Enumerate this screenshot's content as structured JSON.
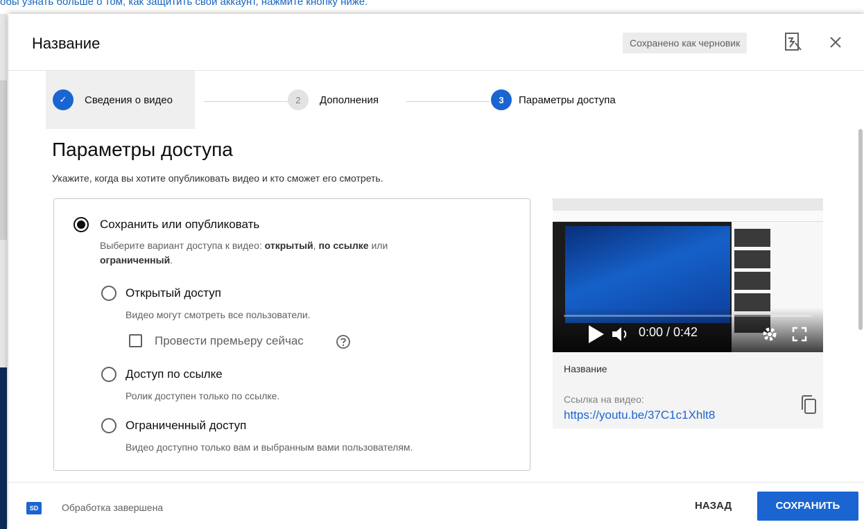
{
  "background": {
    "text": "обы узнать больше о том, как защитить свой аккаунт, нажмите кнопку ниже."
  },
  "header": {
    "title": "Название",
    "draft_status": "Сохранено как черновик",
    "feedback_icon": "feedback-icon",
    "close_icon": "close-icon"
  },
  "stepper": {
    "steps": [
      {
        "number": "✓",
        "label": "Сведения о видео",
        "state": "done"
      },
      {
        "number": "2",
        "label": "Дополнения",
        "state": "inactive"
      },
      {
        "number": "3",
        "label": "Параметры доступа",
        "state": "active"
      }
    ]
  },
  "main": {
    "title": "Параметры доступа",
    "description": "Укажите, когда вы хотите опубликовать видео и кто сможет его смотреть.",
    "save_or_publish": {
      "label": "Сохранить или опубликовать",
      "sub_prefix": "Выберите вариант доступа к видео: ",
      "sub_public": "открытый",
      "sub_sep": ", ",
      "sub_unlisted": "по ссылке",
      "sub_or": " или",
      "sub_private": "ограниченный",
      "sub_end": ".",
      "checked": true
    },
    "options": [
      {
        "label": "Открытый доступ",
        "description": "Видео могут смотреть все пользователи.",
        "checked": false
      },
      {
        "label": "Доступ по ссылке",
        "description": "Ролик доступен только по ссылке.",
        "checked": false
      },
      {
        "label": "Ограниченный доступ",
        "description": "Видео доступно только вам и выбранным вами пользователям.",
        "checked": false
      }
    ],
    "premiere": {
      "label": "Провести премьеру сейчас",
      "checked": false
    }
  },
  "preview": {
    "time": "0:00 / 0:42",
    "title_label": "Название",
    "link_caption": "Ссылка на видео:",
    "link": "https://youtu.be/37C1c1Xhlt8"
  },
  "footer": {
    "badge": "SD",
    "status": "Обработка завершена",
    "back_label": "НАЗАД",
    "save_label": "СОХРАНИТЬ"
  },
  "colors": {
    "accent": "#1a65d1",
    "text": "#0d0d0d",
    "secondary_text": "#606060"
  }
}
